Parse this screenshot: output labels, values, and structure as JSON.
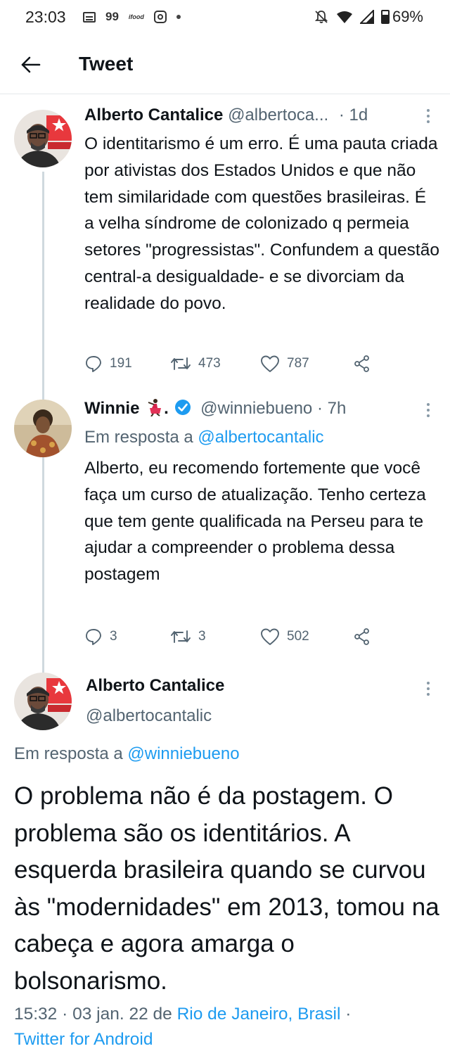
{
  "status_bar": {
    "time": "23:03",
    "news_badge": "99",
    "small_label": "ifood",
    "battery": "69%"
  },
  "header": {
    "title": "Tweet"
  },
  "tweet1": {
    "name": "Alberto Cantalice",
    "handle": "@albertoca...",
    "time": "· 1d",
    "body": "O identitarismo é um erro. É uma pauta criada por ativistas dos Estados Unidos e que não tem similaridade com questões brasileiras. É a velha síndrome de colonizado q permeia setores \"progressistas\". Confundem a questão central-a desigualdade- e se divorciam da realidade do povo.",
    "replies": "191",
    "retweets": "473",
    "likes": "787"
  },
  "tweet2": {
    "name": "Winnie",
    "handle": "@winniebueno",
    "time": "· 7h",
    "reply_prefix": "Em resposta a",
    "reply_to": "@albertocantalic",
    "body": "Alberto, eu recomendo fortemente que você faça um  curso de atualização. Tenho certeza que tem gente qualificada na Perseu para te ajudar a compreender o problema dessa postagem",
    "replies": "3",
    "retweets": "3",
    "likes": "502"
  },
  "main_tweet": {
    "name": "Alberto Cantalice",
    "handle": "@albertocantalic",
    "reply_prefix": "Em resposta a",
    "reply_to": "@winniebueno",
    "body": "O problema não é da postagem. O problema são os identitários. A esquerda brasileira quando se curvou às \"modernidades\" em 2013, tomou na cabeça e agora amarga o bolsonarismo.",
    "timestamp": "15:32 · 03 jan. 22 de",
    "location": "Rio de Janeiro, Brasil",
    "separator": "·",
    "client": "Twitter for Android"
  },
  "colors": {
    "link": "#1d9bf0",
    "secondary_text": "#536471",
    "verified": "#1d9bf0"
  }
}
